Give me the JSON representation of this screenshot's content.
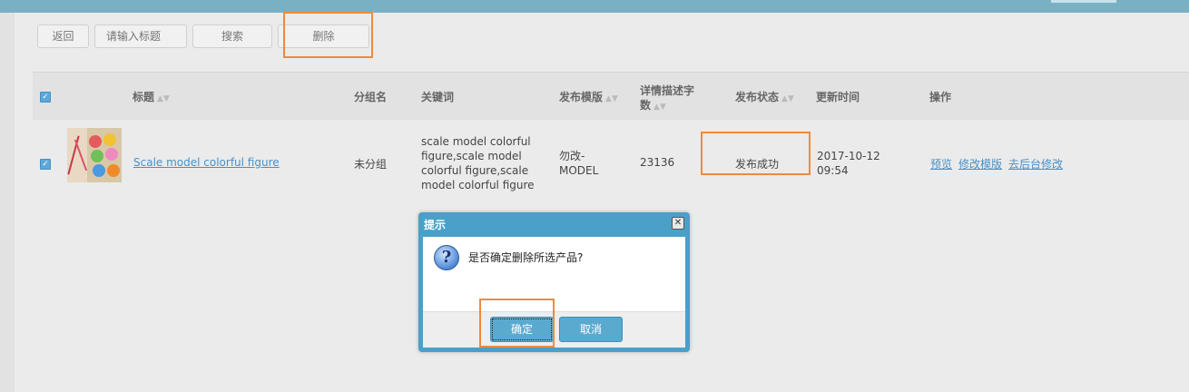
{
  "toolbar": {
    "back_label": "返回",
    "title_input_placeholder": "请输入标题",
    "search_label": "搜索",
    "delete_label": "删除"
  },
  "table": {
    "headers": {
      "title": "标题",
      "group": "分组名",
      "keywords": "关键词",
      "template": "发布模版",
      "detail_chars_line1": "详情描述字",
      "detail_chars_line2": "数",
      "status": "发布状态",
      "updated": "更新时间",
      "actions": "操作"
    },
    "rows": [
      {
        "title": "Scale model colorful figure",
        "group": "未分组",
        "keywords_lines": [
          "scale model colorful",
          "figure,scale model",
          "colorful figure,scale",
          "model colorful figure"
        ],
        "template_lines": [
          "勿改-",
          "MODEL"
        ],
        "detail_chars": "23136",
        "status": "发布成功",
        "updated_date": "2017-10-12",
        "updated_time": "09:54",
        "actions": [
          "预览",
          "修改模版",
          "去后台修改"
        ]
      }
    ]
  },
  "dialog": {
    "title": "提示",
    "close_glyph": "✕",
    "icon_glyph": "?",
    "message": "是否确定删除所选产品?",
    "confirm_label": "确定",
    "cancel_label": "取消"
  },
  "colors": {
    "topbar": "#7ab0c4",
    "highlight": "#f08a3a",
    "dialog_frame": "#4aa0c8",
    "button_blue": "#5aaad0",
    "link": "#4a90c4"
  },
  "icons": {
    "checkbox": "check-icon",
    "sort": "sort-icon",
    "dialog_close": "close-icon",
    "dialog_question": "question-icon"
  }
}
